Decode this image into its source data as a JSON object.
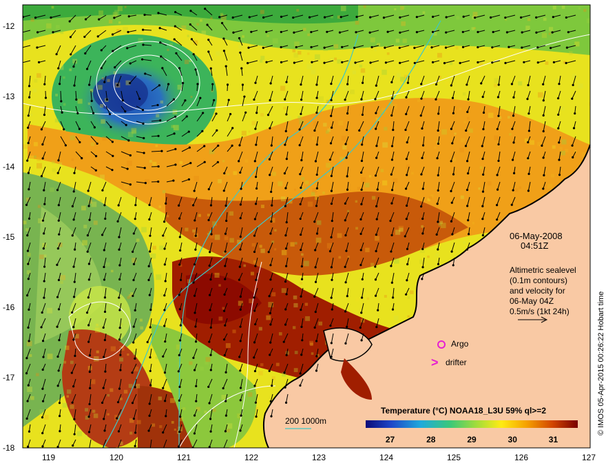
{
  "map": {
    "date": "06-May-2008",
    "time": "04:51Z",
    "credit": "© IMOS 05-Apr-2015 00:26:22 Hobart time",
    "lat_labels": [
      "-12",
      "-13",
      "-14",
      "-15",
      "-16",
      "-17",
      "-18"
    ],
    "lon_labels": [
      "119",
      "120",
      "121",
      "122",
      "123",
      "124",
      "125",
      "126",
      "127"
    ],
    "lat_range": [
      -18,
      -12
    ],
    "lon_range": [
      118.6,
      127
    ],
    "altimetry_lines": [
      "Altimetric sealevel",
      "(0.1m contours)",
      "and velocity for",
      "06-May 04Z",
      "0.5m/s (1kt 24h)"
    ],
    "argo_label": "Argo",
    "drifter_label": "drifter",
    "drifter_symbol": ">",
    "bathymetry_label": "200  1000m",
    "colorbar": {
      "title": "Temperature (°C) NOAA18_L3U 59% ql>=2",
      "ticks": [
        "27",
        "28",
        "29",
        "30",
        "31"
      ],
      "range": [
        26.4,
        31.6
      ]
    },
    "colors": {
      "land": "#f9c9a4",
      "argo": "#e61ed2",
      "bathymetry": "#3cc8c8",
      "contour": "#ffffff"
    },
    "icons": [
      "velocity-arrow-icon",
      "argo-float-icon",
      "drifter-icon"
    ]
  }
}
